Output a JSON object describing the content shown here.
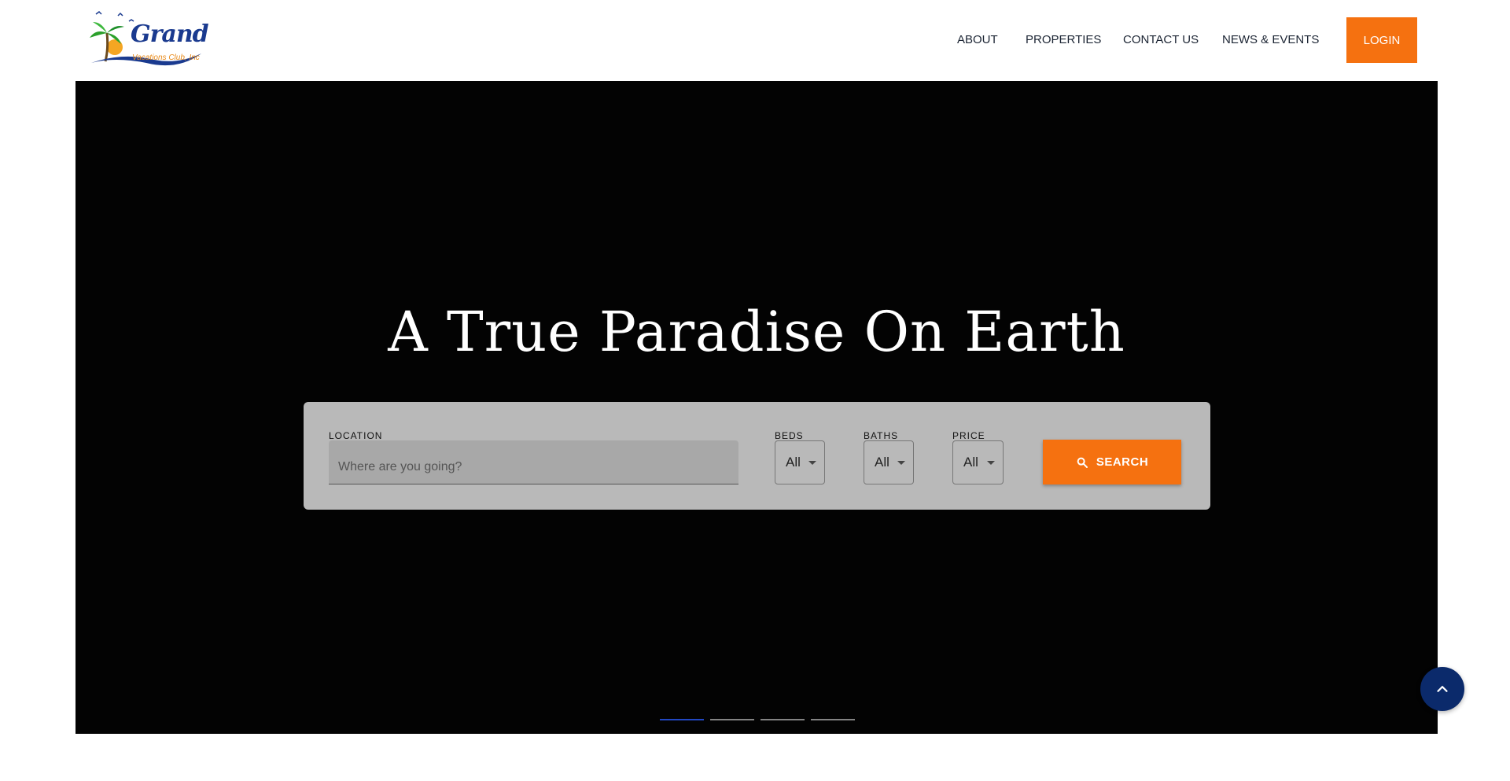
{
  "logo": {
    "name": "Grand",
    "subtitle": "Vacations Club, Inc"
  },
  "nav": {
    "items": [
      {
        "label": "ABOUT"
      },
      {
        "label": "PROPERTIES"
      },
      {
        "label": "CONTACT US"
      },
      {
        "label": "NEWS & EVENTS"
      }
    ],
    "login_label": "LOGIN"
  },
  "hero": {
    "title": "A True Paradise On Earth",
    "search": {
      "location_label": "LOCATION",
      "location_placeholder": "Where are you going?",
      "beds_label": "BEDS",
      "beds_value": "All",
      "baths_label": "BATHS",
      "baths_value": "All",
      "price_label": "PRICE",
      "price_value": "All",
      "search_label": "SEARCH"
    },
    "slides": {
      "count": 4,
      "active": 1
    }
  },
  "colors": {
    "accent": "#f57110",
    "brand": "#0b2a6b",
    "hero_bg": "#030303",
    "panel": "#b9b9b9"
  },
  "icons": {
    "search": "search-icon",
    "scroll_top": "chevron-up-icon",
    "select_caret": "caret-down-icon"
  }
}
